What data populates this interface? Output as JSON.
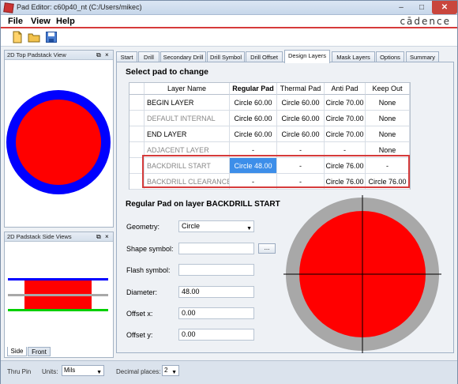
{
  "window": {
    "title": "Pad Editor: c60p40_nt  (C:/Users/mikec)",
    "minimize": "–",
    "maximize": "□",
    "close": "✕"
  },
  "menu": {
    "items": [
      "File",
      "View",
      "Help"
    ],
    "brand": "cādence"
  },
  "toolbar": {
    "icons": [
      "new-file-icon",
      "open-folder-icon",
      "save-icon"
    ]
  },
  "panels": {
    "top_view": {
      "title": "2D Top Padstack View",
      "float": "⧉",
      "close": "×"
    },
    "side_view": {
      "title": "2D Padstack Side Views",
      "float": "⧉",
      "close": "×",
      "tabs": [
        "Side",
        "Front"
      ]
    }
  },
  "tabs": [
    "Start",
    "Drill",
    "Secondary Drill",
    "Drill Symbol",
    "Drill Offset",
    "Design Layers",
    "Mask Layers",
    "Options",
    "Summary"
  ],
  "active_tab": "Design Layers",
  "select_pad": {
    "title": "Select pad to change",
    "columns": [
      "Layer Name",
      "Regular Pad",
      "Thermal Pad",
      "Anti Pad",
      "Keep Out"
    ],
    "rows": [
      {
        "layer": "BEGIN LAYER",
        "regular": "Circle 60.00",
        "thermal": "Circle 60.00",
        "anti": "Circle 70.00",
        "keep": "None"
      },
      {
        "layer": "DEFAULT INTERNAL",
        "regular": "Circle 60.00",
        "thermal": "Circle 60.00",
        "anti": "Circle 70.00",
        "keep": "None"
      },
      {
        "layer": "END LAYER",
        "regular": "Circle 60.00",
        "thermal": "Circle 60.00",
        "anti": "Circle 70.00",
        "keep": "None"
      },
      {
        "layer": "ADJACENT LAYER",
        "regular": "-",
        "thermal": "-",
        "anti": "-",
        "keep": "None"
      },
      {
        "layer": "BACKDRILL START",
        "regular": "Circle 48.00",
        "thermal": "-",
        "anti": "Circle 76.00",
        "keep": "-"
      },
      {
        "layer": "BACKDRILL CLEARANCE",
        "regular": "-",
        "thermal": "-",
        "anti": "Circle 76.00",
        "keep": "Circle 76.00"
      }
    ]
  },
  "regular_pad": {
    "title": "Regular Pad on layer BACKDRILL START",
    "geometry_label": "Geometry:",
    "geometry_value": "Circle",
    "shape_label": "Shape symbol:",
    "shape_value": "",
    "browse": "...",
    "flash_label": "Flash symbol:",
    "flash_value": "",
    "diameter_label": "Diameter:",
    "diameter_value": "48.00",
    "offsetx_label": "Offset x:",
    "offsetx_value": "0.00",
    "offsety_label": "Offset y:",
    "offsety_value": "0.00"
  },
  "status": {
    "mode": "Thru Pin",
    "units_label": "Units:",
    "units_value": "Mils",
    "decimals_label": "Decimal places:",
    "decimals_value": "2"
  },
  "colors": {
    "pad_red": "#ff0000",
    "anti_blue": "#0000ff",
    "preview_grey": "#a8a8a8",
    "select_blue": "#3d8ee9",
    "highlight_red": "#d53b3b"
  }
}
